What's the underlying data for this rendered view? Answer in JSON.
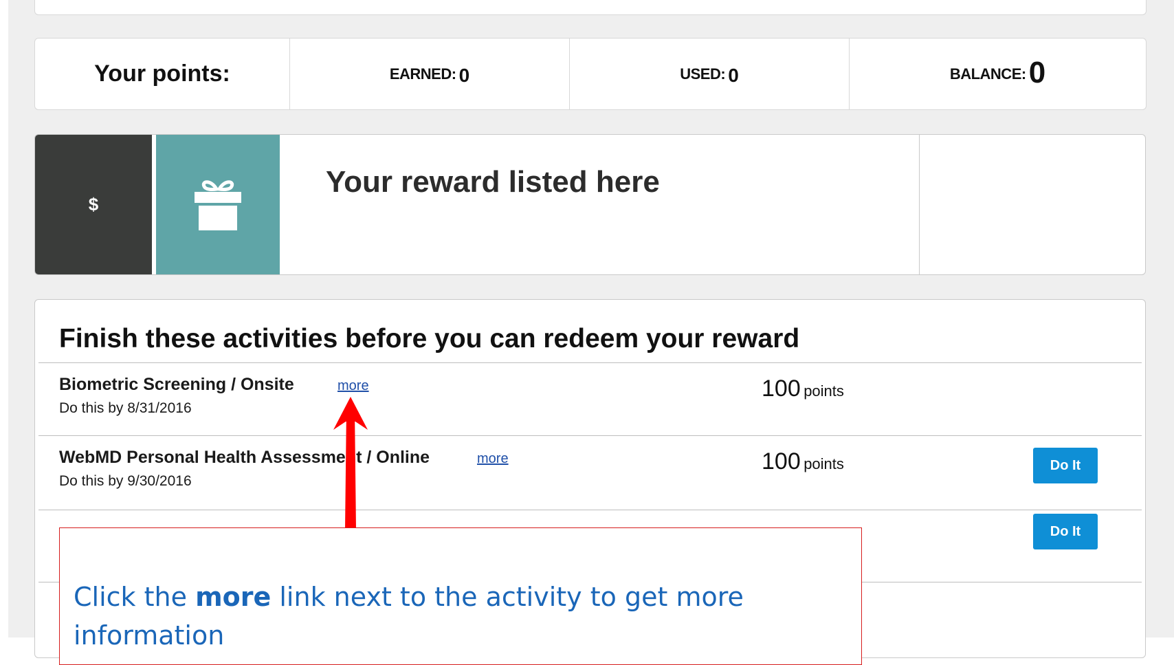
{
  "points": {
    "title": "Your points:",
    "earned_label": "EARNED:",
    "earned_value": "0",
    "used_label": "USED:",
    "used_value": "0",
    "balance_label": "BALANCE:",
    "balance_value": "0"
  },
  "reward": {
    "currency_symbol": "$",
    "title": "Your reward listed here",
    "icon": "gift-icon"
  },
  "activities": {
    "heading": "Finish these activities before you can redeem your reward",
    "items": [
      {
        "name": "Biometric Screening / Onsite",
        "more_label": "more",
        "due": "Do this by 8/31/2016",
        "points_value": "100",
        "points_unit": "points",
        "action": ""
      },
      {
        "name": "WebMD Personal Health Assessment / Online",
        "more_label": "more",
        "due": "Do this by 9/30/2016",
        "points_value": "100",
        "points_unit": "points",
        "action": "Do It"
      },
      {
        "name": "",
        "more_label": "",
        "due": "",
        "points_value": "",
        "points_unit": "",
        "action": "Do It"
      }
    ]
  },
  "callout": {
    "prefix": "Click the ",
    "emphasis": "more",
    "suffix": " link next to the activity to get more information"
  },
  "colors": {
    "dark_tile": "#3a3c3a",
    "gift_tile": "#5fa5a7",
    "button_blue": "#0f8fd6",
    "link_blue": "#1f4fa8",
    "callout_border": "#d61c1c",
    "callout_text": "#1a66b8",
    "arrow_red": "#ff0000"
  }
}
